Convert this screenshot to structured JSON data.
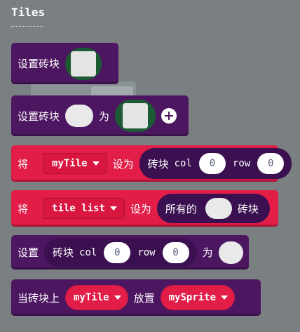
{
  "category": {
    "title": "Tiles"
  },
  "blocks": {
    "set_tile": {
      "label": "设置砖块"
    },
    "set_tile_as": {
      "label": "设置砖块",
      "as": "为"
    },
    "set_var_tile_loc": {
      "set": "将",
      "var": "myTile",
      "to": "设为",
      "reporter": {
        "label": "砖块",
        "col": "col",
        "col_val": "0",
        "row": "row",
        "row_val": "0"
      }
    },
    "set_tile_list": {
      "set": "将",
      "var": "tile list",
      "to": "设为",
      "reporter": {
        "label": "所有的",
        "suffix": "砖块"
      }
    },
    "set_at_tile": {
      "set": "设置",
      "reporter": {
        "label": "砖块",
        "col": "col",
        "col_val": "0",
        "row": "row",
        "row_val": "0"
      },
      "as": "为"
    },
    "place_on_tile": {
      "label": "当砖块上",
      "var1": "myTile",
      "place": "放置",
      "var2": "mySprite"
    }
  },
  "colors": {
    "background": "#7a7f82",
    "purple": "#4c1661",
    "red": "#e11d48",
    "tile_slot": "#1b5a33"
  }
}
